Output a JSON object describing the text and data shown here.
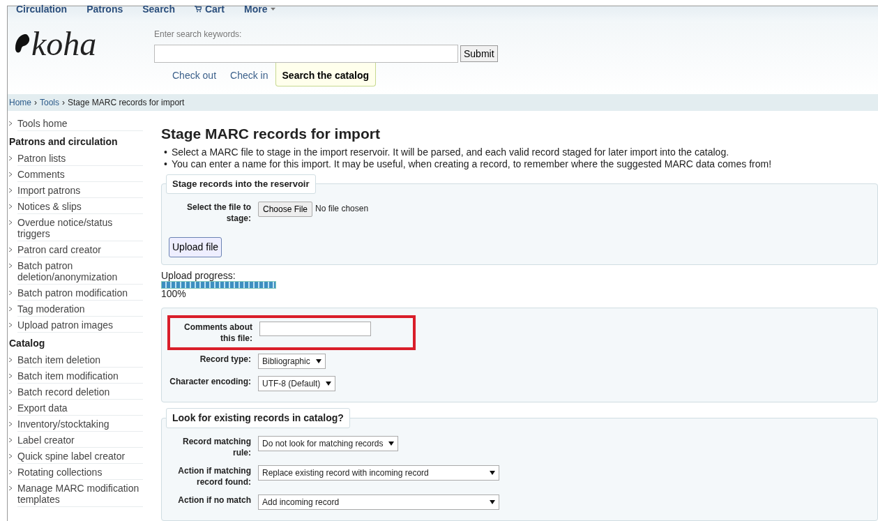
{
  "top_nav": [
    {
      "kind": "link",
      "label": "Circulation"
    },
    {
      "kind": "link",
      "label": "Patrons"
    },
    {
      "kind": "link",
      "label": "Search"
    },
    {
      "kind": "cart",
      "label": "Cart"
    },
    {
      "kind": "dropdown",
      "label": "More"
    }
  ],
  "logo": {
    "text": "koha"
  },
  "search": {
    "label": "Enter search keywords:",
    "submit": "Submit",
    "tabs": [
      {
        "label": "Check out",
        "selected": false
      },
      {
        "label": "Check in",
        "selected": false
      },
      {
        "label": "Search the catalog",
        "selected": true
      }
    ]
  },
  "breadcrumb": {
    "separator": "›",
    "items": [
      "Home",
      "Tools",
      "Stage MARC records for import"
    ]
  },
  "sidebar": [
    {
      "kind": "link",
      "label": "Tools home"
    },
    {
      "kind": "heading",
      "label": "Patrons and circulation"
    },
    {
      "kind": "link",
      "label": "Patron lists"
    },
    {
      "kind": "link",
      "label": "Comments"
    },
    {
      "kind": "link",
      "label": "Import patrons"
    },
    {
      "kind": "link",
      "label": "Notices & slips"
    },
    {
      "kind": "link",
      "label": "Overdue notice/status triggers"
    },
    {
      "kind": "link",
      "label": "Patron card creator"
    },
    {
      "kind": "link",
      "label": "Batch patron deletion/anonymization"
    },
    {
      "kind": "link",
      "label": "Batch patron modification"
    },
    {
      "kind": "link",
      "label": "Tag moderation"
    },
    {
      "kind": "link",
      "label": "Upload patron images"
    },
    {
      "kind": "heading",
      "label": "Catalog"
    },
    {
      "kind": "link",
      "label": "Batch item deletion"
    },
    {
      "kind": "link",
      "label": "Batch item modification"
    },
    {
      "kind": "link",
      "label": "Batch record deletion"
    },
    {
      "kind": "link",
      "label": "Export data"
    },
    {
      "kind": "link",
      "label": "Inventory/stocktaking"
    },
    {
      "kind": "link",
      "label": "Label creator"
    },
    {
      "kind": "link",
      "label": "Quick spine label creator"
    },
    {
      "kind": "link",
      "label": "Rotating collections"
    },
    {
      "kind": "link",
      "label": "Manage MARC modification templates"
    }
  ],
  "page_title": "Stage MARC records for import",
  "bullet": "•",
  "instructions": [
    "Select a MARC file to stage in the import reservoir. It will be parsed, and each valid record staged for later import into the catalog.",
    "You can enter a name for this import. It may be useful, when creating a record, to remember where the suggested MARC data comes from!"
  ],
  "sections": [
    {
      "kind": "fieldset",
      "legend": "Stage records into the reservoir",
      "button": "Upload file",
      "fields": [
        {
          "kind": "file",
          "label": "Select the file to stage:",
          "button": "Choose File",
          "value": "No file chosen",
          "highlighted": false
        }
      ]
    },
    {
      "kind": "progress",
      "label": "Upload progress:",
      "level": 1,
      "reading": "100%"
    },
    {
      "kind": "fieldset",
      "fields": [
        {
          "kind": "text",
          "label": "Comments about this file:",
          "highlighted": true
        },
        {
          "kind": "select",
          "label": "Record type:",
          "value": "Bibliographic",
          "highlighted": false
        },
        {
          "kind": "select",
          "label": "Character encoding:",
          "value": "UTF-8 (Default)",
          "highlighted": false
        }
      ]
    },
    {
      "kind": "fieldset",
      "legend": "Look for existing records in catalog?",
      "fields": [
        {
          "kind": "select",
          "label": "Record matching rule:",
          "value": "Do not look for matching records",
          "highlighted": false
        },
        {
          "kind": "select",
          "label": "Action if matching record found:",
          "value": "Replace existing record with incoming record",
          "highlighted": false,
          "wide": true
        },
        {
          "kind": "select",
          "label": "Action if no match",
          "value": "Add incoming record",
          "highlighted": false,
          "wide": true
        }
      ]
    }
  ]
}
